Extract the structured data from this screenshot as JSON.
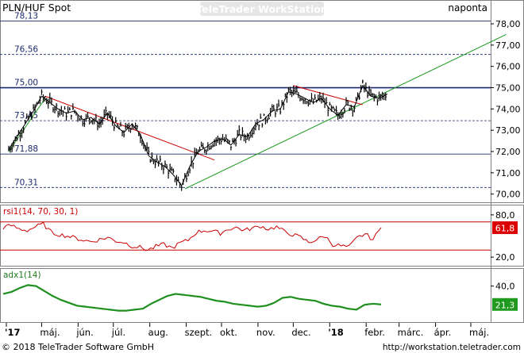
{
  "header": {
    "symbol": "PLN/HUF Spot",
    "watermark": "TeleTrader WorkStation",
    "period": "naponta"
  },
  "footer": {
    "copyright": "© 2018 TeleTrader Software GmbH",
    "url": "http://workstation.teletrader.com"
  },
  "colors": {
    "price": "#000000",
    "rsi_line": "#cc0000",
    "rsi_level": "#cc0000",
    "adx_line": "#1f8f1f",
    "trend_up": "#1a9a1a",
    "trend_down": "#cc0000",
    "hline": "#1a2a6e",
    "rsi_badge": "#dd0000",
    "adx_badge": "#1f9a1f"
  },
  "chart_data": [
    {
      "type": "line",
      "title": "PLN/HUF Spot",
      "x_ticks": [
        "'17",
        "máj.",
        "jún.",
        "júl.",
        "aug.",
        "szept.",
        "okt.",
        "nov.",
        "dec.",
        "'18",
        "febr.",
        "márc.",
        "ápr.",
        "máj."
      ],
      "y_ticks": [
        "78,00",
        "77,00",
        "76,00",
        "75,00",
        "74,00",
        "73,00",
        "72,00",
        "71,00",
        "70,00"
      ],
      "ylim": [
        69.8,
        78.3
      ],
      "grid": false,
      "horizontal_levels": [
        {
          "label": "78,13",
          "value": 78.13,
          "style": "solid"
        },
        {
          "label": "76,56",
          "value": 76.56,
          "style": "dashed"
        },
        {
          "label": "75,00",
          "value": 75.0,
          "style": "solid-bold"
        },
        {
          "label": "73,45",
          "value": 73.45,
          "style": "dashed"
        },
        {
          "label": "71,88",
          "value": 71.88,
          "style": "solid"
        },
        {
          "label": "70,31",
          "value": 70.31,
          "style": "dashed"
        }
      ],
      "series": [
        {
          "x": [
            "2017-04-03",
            "2017-04-10",
            "2017-04-17",
            "2017-04-24",
            "2017-05-01",
            "2017-05-08",
            "2017-05-15",
            "2017-05-22",
            "2017-05-29",
            "2017-06-05",
            "2017-06-12",
            "2017-06-19",
            "2017-06-26",
            "2017-07-03",
            "2017-07-10",
            "2017-07-17",
            "2017-07-24",
            "2017-07-31",
            "2017-08-07",
            "2017-08-14",
            "2017-08-21",
            "2017-08-28",
            "2017-09-04",
            "2017-09-11",
            "2017-09-18",
            "2017-09-25",
            "2017-10-02",
            "2017-10-09",
            "2017-10-16",
            "2017-10-23",
            "2017-10-30",
            "2017-11-06",
            "2017-11-13",
            "2017-11-20",
            "2017-11-27",
            "2017-12-04",
            "2017-12-11",
            "2017-12-18",
            "2017-12-25",
            "2018-01-01",
            "2018-01-08",
            "2018-01-15",
            "2018-01-22",
            "2018-01-29",
            "2018-02-05",
            "2018-02-12",
            "2018-02-19"
          ],
          "values": [
            72.1,
            72.7,
            73.3,
            73.9,
            74.6,
            74.3,
            74.0,
            73.8,
            73.9,
            73.5,
            73.6,
            73.3,
            73.8,
            73.2,
            72.9,
            73.3,
            72.8,
            71.8,
            71.5,
            71.3,
            70.9,
            70.4,
            71.3,
            72.0,
            72.2,
            72.5,
            72.6,
            72.3,
            72.8,
            72.7,
            73.3,
            73.5,
            73.9,
            74.0,
            74.8,
            74.7,
            74.5,
            74.3,
            74.5,
            74.0,
            73.7,
            74.2,
            74.1,
            75.1,
            74.6,
            74.5,
            74.7
          ]
        }
      ],
      "trendlines": [
        {
          "color": "trend_up",
          "from": [
            "2017-04-03",
            72.0
          ],
          "to": [
            "2017-05-04",
            74.5
          ]
        },
        {
          "color": "trend_down",
          "from": [
            "2017-05-04",
            74.6
          ],
          "to": [
            "2017-09-25",
            71.6
          ]
        },
        {
          "color": "trend_up",
          "from": [
            "2017-08-31",
            70.25
          ],
          "to": [
            "2018-05-31",
            77.5
          ]
        },
        {
          "color": "trend_down",
          "from": [
            "2017-12-01",
            75.1
          ],
          "to": [
            "2018-01-29",
            74.2
          ]
        }
      ]
    },
    {
      "type": "line",
      "title": "rsi1(14, 70, 30, 1)",
      "y_ticks": [
        "80,0",
        "20,0"
      ],
      "ylim": [
        10,
        90
      ],
      "levels": [
        70,
        30
      ],
      "last_value": "61,8",
      "series": [
        {
          "values": [
            62,
            65,
            60,
            58,
            63,
            67,
            55,
            52,
            50,
            47,
            44,
            42,
            45,
            48,
            43,
            41,
            36,
            34,
            30,
            35,
            38,
            33,
            40,
            44,
            55,
            58,
            57,
            54,
            60,
            62,
            58,
            61,
            64,
            60,
            63,
            56,
            52,
            48,
            41,
            45,
            50,
            38,
            36,
            34,
            47,
            53,
            45,
            61.8
          ]
        }
      ]
    },
    {
      "type": "line",
      "title": "adx1(14)",
      "y_ticks": [
        "40,0"
      ],
      "ylim": [
        5,
        55
      ],
      "last_value": "21,3",
      "series": [
        {
          "values": [
            32,
            34,
            38,
            41,
            40,
            35,
            30,
            26,
            23,
            20,
            19,
            18,
            17,
            16,
            15,
            15,
            16,
            17,
            22,
            26,
            30,
            32,
            31,
            30,
            29,
            27,
            25,
            24,
            22,
            21,
            20,
            19,
            20,
            23,
            28,
            29,
            27,
            26,
            25,
            22,
            20,
            19,
            17,
            16,
            21,
            22,
            21.3
          ]
        }
      ]
    }
  ]
}
